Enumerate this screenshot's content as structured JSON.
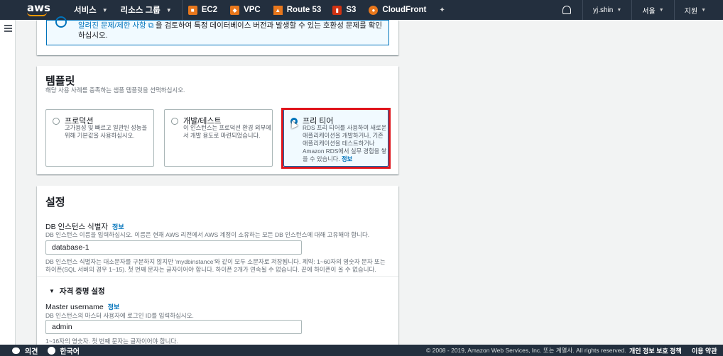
{
  "topnav": {
    "logo": "aws",
    "services": "서비스",
    "resource_groups": "리소스 그룹",
    "shortcuts": [
      {
        "label": "EC2",
        "color": "#e8771c",
        "icon": "ec2-icon"
      },
      {
        "label": "VPC",
        "color": "#e8771c",
        "icon": "vpc-icon"
      },
      {
        "label": "Route 53",
        "color": "#e8771c",
        "icon": "route53-icon"
      },
      {
        "label": "S3",
        "color": "#d13212",
        "icon": "s3-icon"
      },
      {
        "label": "CloudFront",
        "color": "#e8771c",
        "icon": "cloudfront-icon"
      }
    ],
    "user": "yj.shin",
    "region": "서울",
    "support": "지원"
  },
  "info_box": {
    "text_pre": "",
    "link": "알려진 문제/제한 사항",
    "text_post": " 을 검토하여 특정 데이터베이스 버전과 발생할 수 있는 호환성 문제를 확인하십시오."
  },
  "template": {
    "title": "템플릿",
    "description": "해당 사용 사례를 충족하는 샘플 템플릿을 선택하십시오.",
    "options": [
      {
        "title": "프로덕션",
        "desc": "고가용성 및 빠르고 일관된 성능을 위해 기본값을 사용하십시오."
      },
      {
        "title": "개발/테스트",
        "desc": "이 인스턴스는 프로덕션 환경 외부에서 개발 용도로 마련되었습니다."
      },
      {
        "title": "프리 티어",
        "desc": "RDS 프리 티어를 사용하여 새로운 애플리케이션을 개발하거나, 기존 애플리케이션을 테스트하거나 Amazon RDS에서 실무 경험을 쌓을 수 있습니다.",
        "info": "정보"
      }
    ],
    "selected_index": 2
  },
  "settings": {
    "title": "설정",
    "db_id_label": "DB 인스턴스 식별자",
    "db_id_info": "정보",
    "db_id_desc": "DB 인스턴스 이름을 입력하십시오. 이름은 현재 AWS 리전에서 AWS 계정이 소유하는 모든 DB 인스턴스에 대해 고유해야 합니다.",
    "db_id_value": "database-1",
    "db_id_constraint_1": "DB 인스턴스 식별자는 대소문자를 구분하지 않지만 'mydbinstance'와 같이 모두 소문자로 저장됩니다. 제약: 1~60자의 영숫자 문자 또는",
    "db_id_constraint_2": "하이픈(SQL 서버의 경우 1~15). 첫 번째 문자는 글자이어야 합니다. 하이픈 2개가 연속될 수 없습니다. 끝에 하이픈이 올 수 없습니다.",
    "credentials_label": "자격 증명 설정",
    "master_user_label": "Master username",
    "master_user_info": "정보",
    "master_user_desc": "DB 인스턴스의 마스터 사용자에 로그인 ID를 입력하십시오.",
    "master_user_value": "admin",
    "master_user_constraint": "1~16자의 영숫자. 첫 번째 문자는 글자이어야 합니다."
  },
  "footer": {
    "feedback": "의견",
    "language": "한국어",
    "copyright": "© 2008 - 2019, Amazon Web Services, Inc. 또는 계열사. All rights reserved.",
    "privacy": "개인 정보 보호 정책",
    "terms": "이용 약관"
  }
}
